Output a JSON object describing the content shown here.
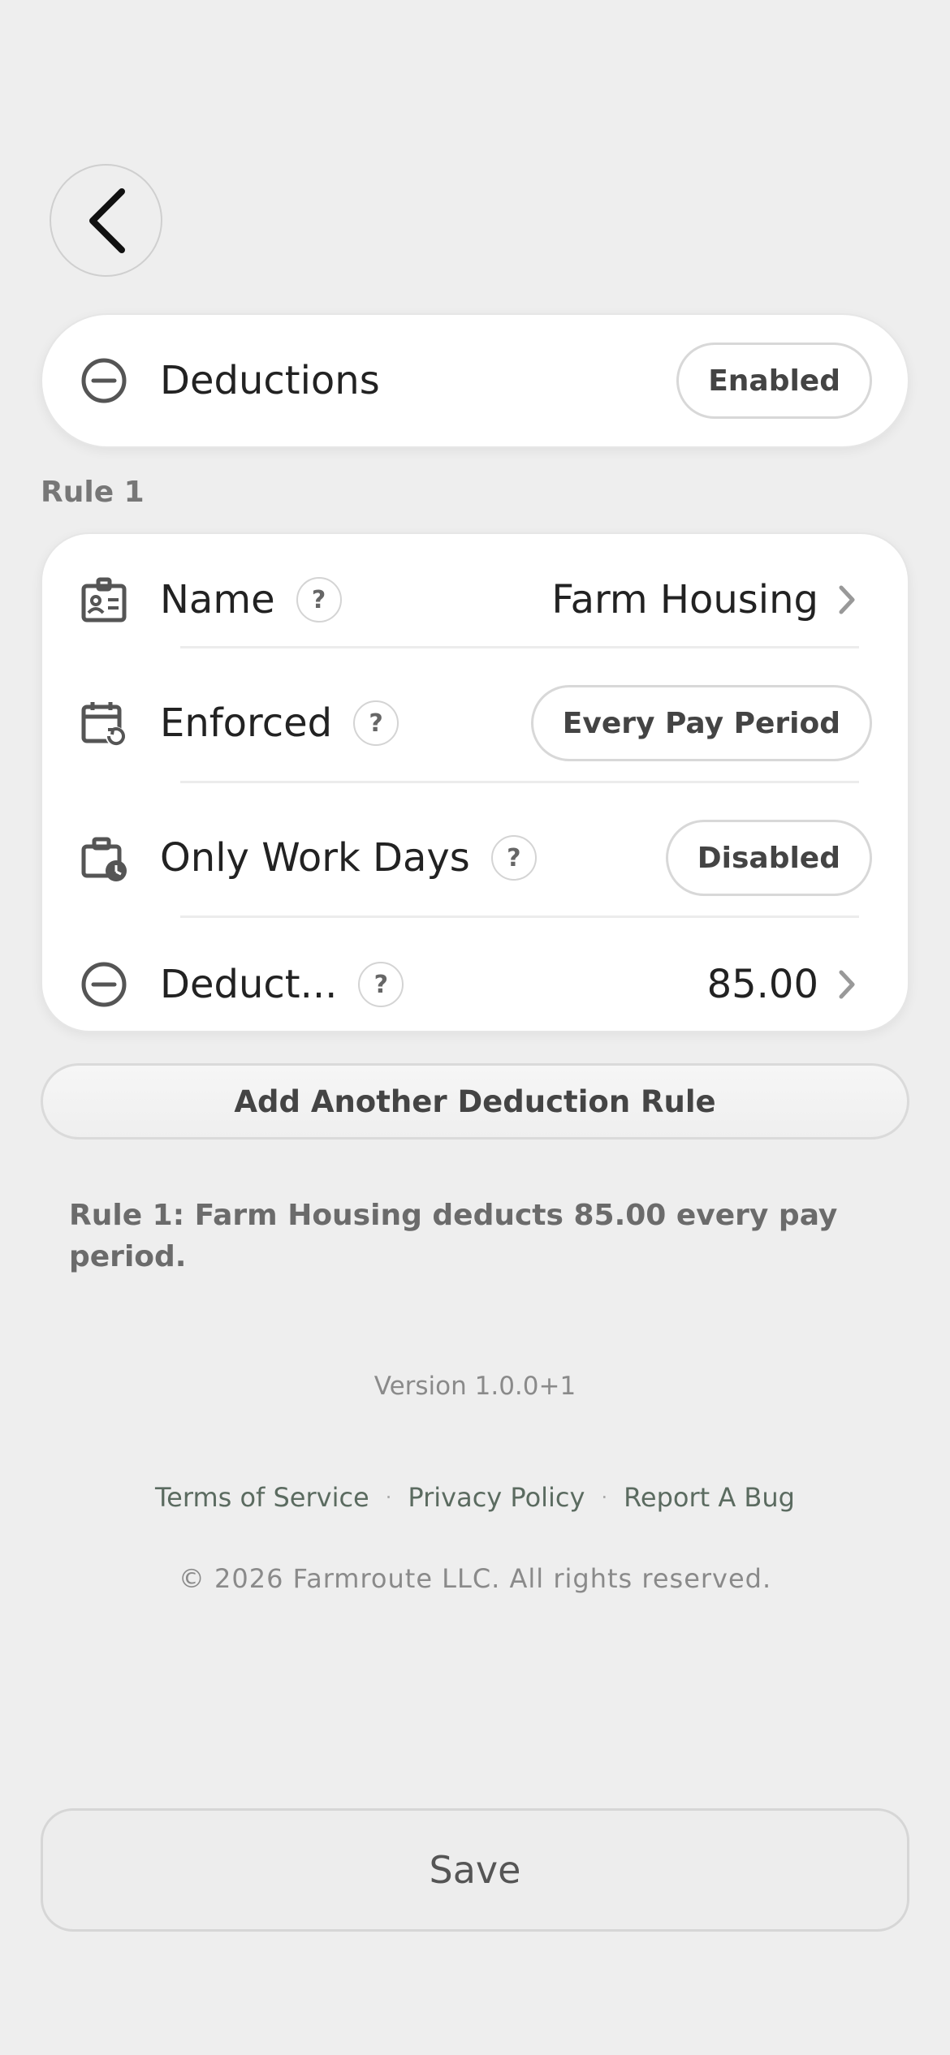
{
  "header": {
    "back_icon": "chevron-left-icon"
  },
  "deductions_toggle": {
    "icon": "minus-circle-icon",
    "label": "Deductions",
    "status": "Enabled"
  },
  "rule": {
    "section_label": "Rule 1",
    "rows": [
      {
        "icon": "id-card-icon",
        "label": "Name",
        "help": "?",
        "value": "Farm Housing"
      },
      {
        "icon": "calendar-repeat-icon",
        "label": "Enforced",
        "help": "?",
        "value": "Every Pay Period"
      },
      {
        "icon": "briefcase-clock-icon",
        "label": "Only Work Days",
        "help": "?",
        "value": "Disabled"
      },
      {
        "icon": "minus-circle-icon",
        "label": "Deduct...",
        "help": "?",
        "value": "85.00"
      }
    ]
  },
  "add_rule_label": "Add Another Deduction Rule",
  "summary": "Rule 1: Farm Housing deducts 85.00 every pay period.",
  "footer": {
    "version": "Version 1.0.0+1",
    "links": [
      "Terms of Service",
      "Privacy Policy",
      "Report A Bug"
    ],
    "separator": "·",
    "copyright": "© 2026 Farmroute LLC. All rights reserved."
  },
  "save_label": "Save"
}
